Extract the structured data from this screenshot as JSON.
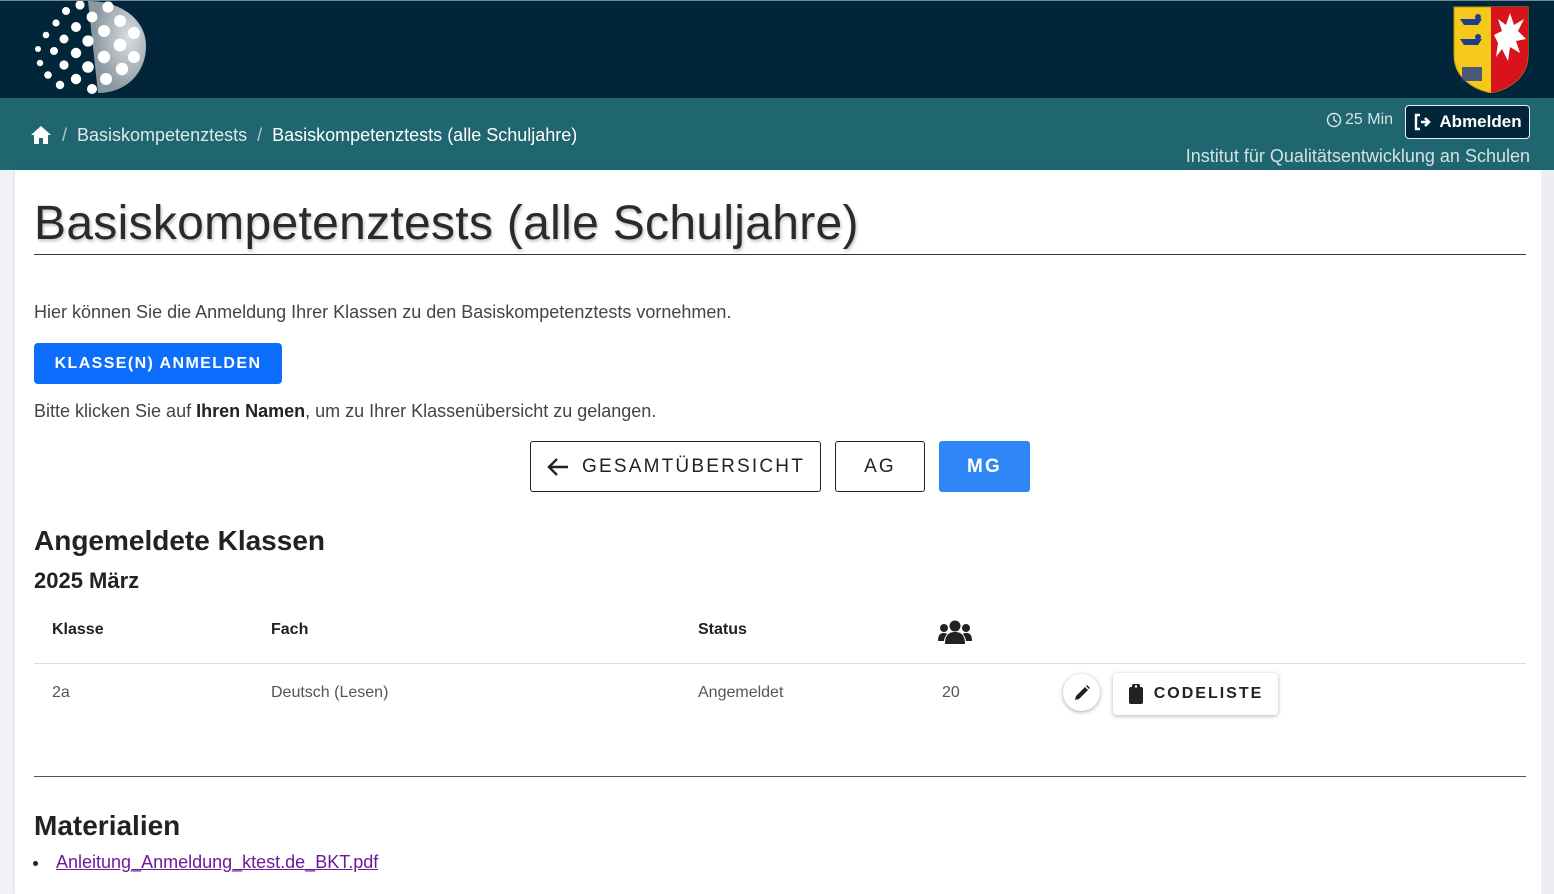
{
  "header": {
    "logo_icon": "dotted-sphere-logo",
    "crest_icon": "schleswig-holstein-crest-icon"
  },
  "nav": {
    "home_icon": "home-icon",
    "breadcrumbs": [
      "Basiskompetenztests",
      "Basiskompetenztests (alle Schuljahre)"
    ],
    "timer": "25 Min",
    "timer_icon": "clock-icon",
    "logout_label": "Abmelden",
    "logout_icon": "sign-out-icon",
    "institute": "Institut für Qualitätsentwicklung an Schulen"
  },
  "page": {
    "title": "Basiskompetenztests (alle Schuljahre)",
    "intro": "Hier können Sie die Anmeldung Ihrer Klassen zu den Basiskompetenztests vornehmen.",
    "register_button": "KLASSE(N) ANMELDEN",
    "hint_before": "Bitte klicken Sie auf ",
    "hint_bold": "Ihren Namen",
    "hint_after": ", um zu Ihrer Klassenübersicht zu gelangen."
  },
  "tabs": {
    "back_label": "GESAMTÜBERSICHT",
    "back_icon": "arrow-left-icon",
    "ag_label": "AG",
    "mg_label": "MG",
    "active": "MG"
  },
  "registered": {
    "heading": "Angemeldete Klassen",
    "period": "2025 März",
    "columns": [
      "Klasse",
      "Fach",
      "Status",
      "users-icon"
    ],
    "rows": [
      {
        "klasse": "2a",
        "fach": "Deutsch (Lesen)",
        "status": "Angemeldet",
        "count": "20"
      }
    ],
    "edit_icon": "pencil-icon",
    "codelist_label": "CODELISTE",
    "codelist_icon": "clipboard-icon"
  },
  "materials": {
    "heading": "Materialien",
    "files": [
      "Anleitung_Anmeldung_ktest.de_BKT.pdf"
    ]
  },
  "colors": {
    "topbar": "#01263a",
    "navbar": "#1f6670",
    "primary": "#0d6efd",
    "active_tab": "#2f86f7",
    "link": "#6a1b9a"
  }
}
